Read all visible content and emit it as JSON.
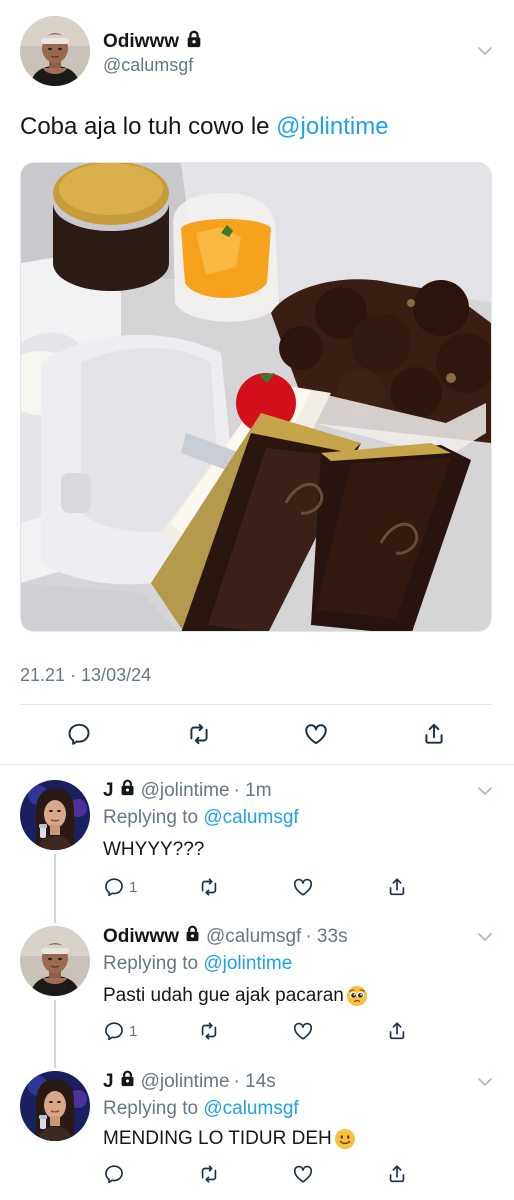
{
  "main_tweet": {
    "author_name": "Odiwww",
    "author_handle": "@calumsgf",
    "text_prefix": "Coba aja lo tuh cowo le ",
    "text_mention": "@jolintime",
    "timestamp": "21.21 · 13/03/24",
    "actions": {
      "reply_icon": "reply-icon",
      "retweet_icon": "retweet-icon",
      "like_icon": "heart-icon",
      "share_icon": "share-icon"
    }
  },
  "replies": [
    {
      "author_name": "J",
      "author_handle": "@jolintime",
      "time": "· 1m",
      "replying_label": "Replying to ",
      "replying_to": "@calumsgf",
      "text": "WHYYY???",
      "emoji": "",
      "reply_count": "1"
    },
    {
      "author_name": "Odiwww",
      "author_handle": "@calumsgf",
      "time": "· 33s",
      "replying_label": "Replying to ",
      "replying_to": "@jolintime",
      "text": "Pasti udah gue ajak pacaran",
      "emoji": "pleading-face",
      "reply_count": "1"
    },
    {
      "author_name": "J",
      "author_handle": "@jolintime",
      "time": "· 14s",
      "replying_label": "Replying to ",
      "replying_to": "@calumsgf",
      "text": "MENDING LO TIDUR DEH",
      "emoji": "slightly-smiling-face",
      "reply_count": ""
    }
  ],
  "colors": {
    "accent": "#1da1f2",
    "secondary_text": "#657786",
    "divider": "#e1e8ed"
  }
}
